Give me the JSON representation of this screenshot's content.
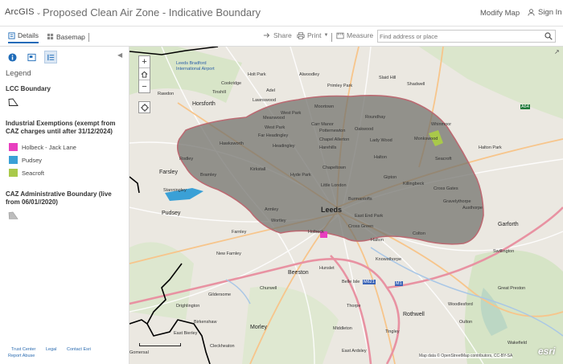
{
  "header": {
    "logo": "ArcGIS",
    "title": "Proposed Clean Air Zone - Indicative Boundary",
    "modify_map": "Modify Map",
    "sign_in": "Sign In"
  },
  "toolbar": {
    "details": "Details",
    "basemap": "Basemap",
    "share": "Share",
    "print": "Print",
    "measure": "Measure",
    "search_placeholder": "Find address or place"
  },
  "panel": {
    "legend_title": "Legend",
    "groups": [
      {
        "heading": "LCC Boundary",
        "items": []
      },
      {
        "heading": "Industrial Exemptions (exempt from CAZ charges until after 31/12/2024)",
        "items": [
          {
            "label": "Holbeck - Jack Lane",
            "color": "#e83fbf"
          },
          {
            "label": "Pudsey",
            "color": "#3aa0d6"
          },
          {
            "label": "Seacroft",
            "color": "#a9c94a"
          }
        ]
      },
      {
        "heading": "CAZ Administrative Boundary (live from 06/01//2020)",
        "items": []
      }
    ],
    "footer": {
      "trust_center": "Trust Center",
      "legal": "Legal",
      "contact": "Contact Esri",
      "report_abuse": "Report Abuse"
    }
  },
  "map": {
    "places": {
      "leeds": "Leeds",
      "leeds_bradford": "Leeds Bradford",
      "international_airport": "International Airport",
      "holt_park": "Holt Park",
      "alwoodley": "Alwoodley",
      "shadwell": "Shadwell",
      "slaid_hill": "Slaid Hill",
      "primley_park": "Primley Park",
      "cookridge": "Cookridge",
      "tinshill": "Tinshill",
      "lawnswood": "Lawnswood",
      "horsforth": "Horsforth",
      "rawdon": "Rawdon",
      "moortown": "Moortown",
      "meanwood": "Meanwood",
      "roundhay": "Roundhay",
      "adel": "Adel",
      "west_park": "West Park",
      "carr_manor": "Carr Manor",
      "far_headingley": "Far Headingley",
      "chapel_allerton": "Chapel Allerton",
      "oakwood": "Oakwood",
      "hawksworth": "Hawksworth",
      "potternewton": "Potternewton",
      "whinmoor": "Whinmoor",
      "headingley": "Headingley",
      "harehills": "Harehills",
      "halton_park": "Halton Park",
      "ladywood": "Lady Wood",
      "monkswood": "Monkswood",
      "seacroft": "Seacroft",
      "kirkstall": "Kirkstall",
      "rodley": "Rodley",
      "farsley": "Farsley",
      "bramley": "Bramley",
      "hyde_park": "Hyde Park",
      "chapeltown": "Chapeltown",
      "little_london": "Little London",
      "gipton": "Gipton",
      "killingbeck": "Killingbeck",
      "cross_gates": "Cross Gates",
      "stanningley": "Stanningley",
      "pudsey": "Pudsey",
      "burmantofts": "Burmantofts",
      "armley": "Armley",
      "east_end_park": "East End Park",
      "gravelythorpe": "Gravelythorpe",
      "austhorpe": "Austhorpe",
      "holbeck": "Holbeck",
      "cross_green": "Cross Green",
      "farnley": "Farnley",
      "wortley": "Wortley",
      "garforth": "Garforth",
      "new_farnley": "New Farnley",
      "colton": "Colton",
      "beeston": "Beeston",
      "hunslet": "Hunslet",
      "knowsthorpe": "Knowsthorpe",
      "halton": "Halton",
      "belle_isle": "Belle Isle",
      "swillington": "Swillington",
      "great_preston": "Great Preston",
      "gildersome": "Gildersome",
      "churwell": "Churwell",
      "rothwell": "Rothwell",
      "woodlesford": "Woodlesford",
      "morley": "Morley",
      "middleton": "Middleton",
      "oulton": "Oulton",
      "gomersal": "Gomersal",
      "east_ardsley": "East Ardsley",
      "drighlington": "Drighlington",
      "tingley": "Tingley",
      "thorpe": "Thorpe",
      "east_bierley": "East Bierley",
      "birkenshaw": "Birkenshaw",
      "cleckheaton": "Cleckheaton",
      "wakefield": "Wakefield",
      "esri": "esri",
      "a64": "A64",
      "m1": "M1",
      "m621": "M621"
    },
    "attribution": "Map data © OpenStreetMap contributors, CC-BY-SA",
    "colors": {
      "caz_fill": "#6f6f6a",
      "boundary_line": "#000000",
      "motorway": "#e892a2",
      "primary_road": "#f7c58b"
    }
  }
}
